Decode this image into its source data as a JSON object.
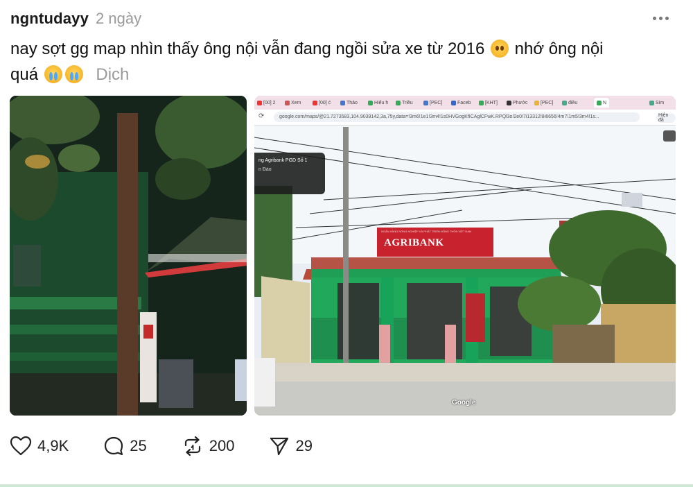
{
  "post": {
    "username": "ngntudayy",
    "time": "2 ngày",
    "text_line1": "nay sợt gg map nhìn thấy ông nội vẫn đang ngồi sửa xe từ 2016",
    "text_line1b": "nhớ ông nội",
    "text_line2": "quá",
    "translate_label": "Dịch"
  },
  "screenshot": {
    "tabs": [
      "[00] 2",
      "Xem",
      "[00] ć",
      "Thảo",
      "Hiếu h",
      "Triều",
      "[PEC]",
      "Faceb",
      "[KHT]",
      "Phước",
      "[PEC]",
      "điều",
      "N",
      "Sim"
    ],
    "url": "google.com/maps/@21.7273583,104.9039142,3a,75y,data=!3m6!1e1!3m4!1s0HVGogKfICAglCFwK.RPQl3o!2e0!7i13312!8i6656!4m7!1m5!3m4!1s...",
    "infocard_title": "ng Agribank PGD Số 1",
    "infocard_sub": "n Đào",
    "bank_name": "AGRIBANK",
    "bank_sub": "NGÂN HÀNG NÔNG NGHIỆP VÀ PHÁT TRIỂN NÔNG THÔN VIỆT NAM",
    "google_logo": "Google",
    "browser_profile": "Hiện đã"
  },
  "actions": {
    "likes": "4,9K",
    "comments": "25",
    "reposts": "200",
    "shares": "29"
  },
  "colors": {
    "username": "#1a1a1a",
    "meta": "#9a9a9a",
    "bank_red": "#c8222e",
    "bank_green": "#1f9e55"
  }
}
